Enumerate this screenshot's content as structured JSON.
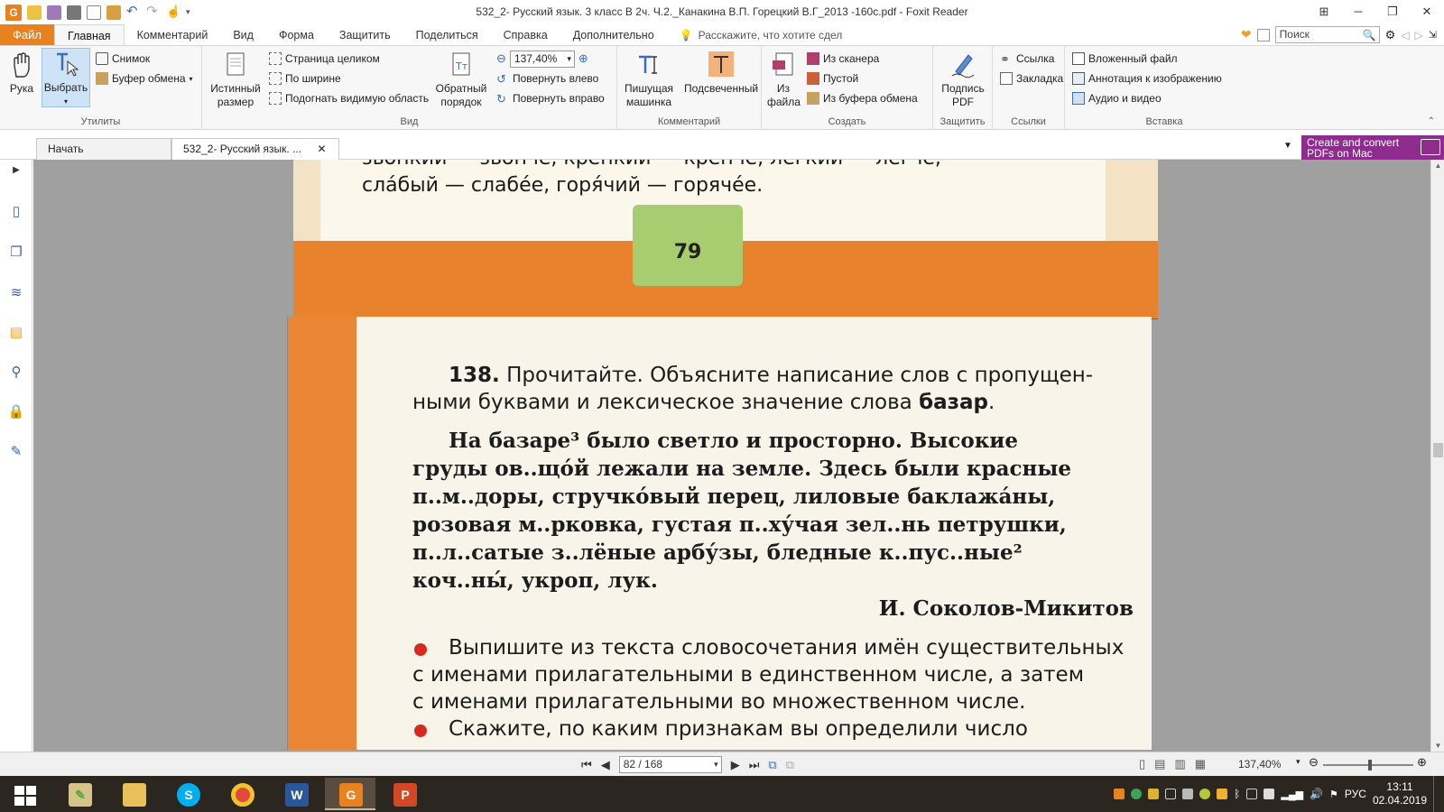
{
  "window": {
    "title": "532_2- Русский язык. 3 класс В 2ч. Ч.2._Канакина В.П. Горецкий В.Г_2013 -160с.pdf - Foxit Reader",
    "app_logo": "G"
  },
  "menu": {
    "file": "Файл",
    "tabs": [
      "Главная",
      "Комментарий",
      "Вид",
      "Форма",
      "Защитить",
      "Поделиться",
      "Справка",
      "Дополнительно"
    ],
    "tell_me": "Расскажите, что хотите сдел",
    "search_placeholder": "Поиск"
  },
  "ribbon": {
    "utilities": {
      "label": "Утилиты",
      "hand": "Рука",
      "select": "Выбрать",
      "snapshot": "Снимок",
      "clipboard": "Буфер обмена"
    },
    "view": {
      "label": "Вид",
      "actual_size_1": "Истинный",
      "actual_size_2": "размер",
      "fit_page": "Страница целиком",
      "fit_width": "По ширине",
      "fit_visible": "Подогнать видимую область",
      "reverse_1": "Обратный",
      "reverse_2": "порядок",
      "zoom_value": "137,40%",
      "rotate_left": "Повернуть влево",
      "rotate_right": "Повернуть вправо"
    },
    "comment": {
      "label": "Комментарий",
      "typewriter_1": "Пишущая",
      "typewriter_2": "машинка",
      "highlight": "Подсвеченный"
    },
    "create": {
      "label": "Создать",
      "from_file_1": "Из",
      "from_file_2": "файла",
      "from_scanner": "Из сканера",
      "blank": "Пустой",
      "from_clipboard": "Из буфера обмена"
    },
    "protect": {
      "label": "Защитить",
      "sign_1": "Подпись",
      "sign_2": "PDF"
    },
    "links": {
      "label": "Ссылки",
      "link": "Ссылка",
      "bookmark": "Закладка"
    },
    "insert": {
      "label": "Вставка",
      "attachment": "Вложенный файл",
      "image_annotation": "Аннотация к изображению",
      "audio_video": "Аудио и видео"
    }
  },
  "tabs": {
    "start": "Начать",
    "document": "532_2- Русский язык. ...",
    "promo_line1": "Create and convert",
    "promo_line2": "PDFs on Mac"
  },
  "page_top": {
    "line1": "звонкий — звонче, крепкий — крепче, легкий — легче,",
    "line2": "сла́бый — слабе́е, горя́чий — горяче́е.",
    "page_number": "79"
  },
  "page_bottom": {
    "exercise_number": "138.",
    "task_line1": "Прочитайте. Объясните написание слов с пропущен-",
    "task_line2_pre": "ными буквами и лексическое значение слова",
    "task_line2_bold": "базар",
    "task_line2_post": ".",
    "text_lines": [
      "На базаре³ было светло и просторно. Высокие",
      "груды ов..що́й лежали на земле. Здесь были красные",
      "п..м..доры, стручко́вый перец, лиловые баклажа́ны,",
      "розовая м..рковка, густая п..ху́чая зел..нь петрушки,",
      "п..л..сатые з..лёные арбу́зы, бледные к..пус..ные²",
      "коч..ны́, укроп, лук."
    ],
    "author": "И. Соколов-Микитов",
    "bullet1_lines": [
      "Выпишите из текста словосочетания имён существительных",
      "с именами прилагательными в единственном числе, а затем",
      "с именами прилагательными во множественном числе."
    ],
    "bullet2_line": "Скажите, по каким признакам вы определили число"
  },
  "status": {
    "page_field": "82 / 168",
    "zoom": "137,40%"
  },
  "taskbar": {
    "language": "РУС",
    "time": "13:11",
    "date": "02.04.2019"
  },
  "colors": {
    "accent": "#e8821e",
    "promo": "#8e2d8e",
    "page_orange": "#ea8636",
    "page_green": "#a8cc70"
  }
}
